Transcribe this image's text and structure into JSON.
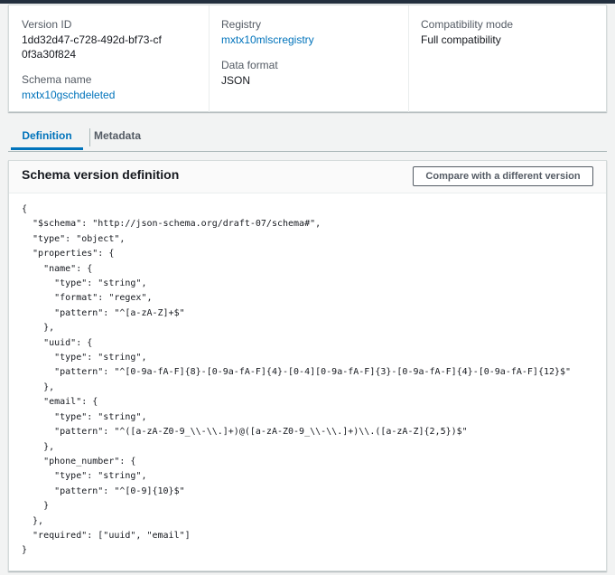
{
  "details": {
    "version_id": {
      "label": "Version ID",
      "value": "1dd32d47-c728-492d-bf73-cf0f3a30f824"
    },
    "schema_name": {
      "label": "Schema name",
      "value": "mxtx10gschdeleted"
    },
    "registry": {
      "label": "Registry",
      "value": "mxtx10mlscregistry"
    },
    "data_format": {
      "label": "Data format",
      "value": "JSON"
    },
    "compatibility_mode": {
      "label": "Compatibility mode",
      "value": "Full compatibility"
    }
  },
  "tabs": [
    {
      "label": "Definition",
      "active": true
    },
    {
      "label": "Metadata",
      "active": false
    }
  ],
  "panel": {
    "title": "Schema version definition",
    "compare_label": "Compare with a different version",
    "code": "{\n  \"$schema\": \"http://json-schema.org/draft-07/schema#\",\n  \"type\": \"object\",\n  \"properties\": {\n    \"name\": {\n      \"type\": \"string\",\n      \"format\": \"regex\",\n      \"pattern\": \"^[a-zA-Z]+$\"\n    },\n    \"uuid\": {\n      \"type\": \"string\",\n      \"pattern\": \"^[0-9a-fA-F]{8}-[0-9a-fA-F]{4}-[0-4][0-9a-fA-F]{3}-[0-9a-fA-F]{4}-[0-9a-fA-F]{12}$\"\n    },\n    \"email\": {\n      \"type\": \"string\",\n      \"pattern\": \"^([a-zA-Z0-9_\\\\-\\\\.]+)@([a-zA-Z0-9_\\\\-\\\\.]+)\\\\.([a-zA-Z]{2,5})$\"\n    },\n    \"phone_number\": {\n      \"type\": \"string\",\n      \"pattern\": \"^[0-9]{10}$\"\n    }\n  },\n  \"required\": [\"uuid\", \"email\"]\n}"
  },
  "colors": {
    "link": "#0073bb",
    "background": "#f2f3f3",
    "topbar": "#232f3e"
  }
}
